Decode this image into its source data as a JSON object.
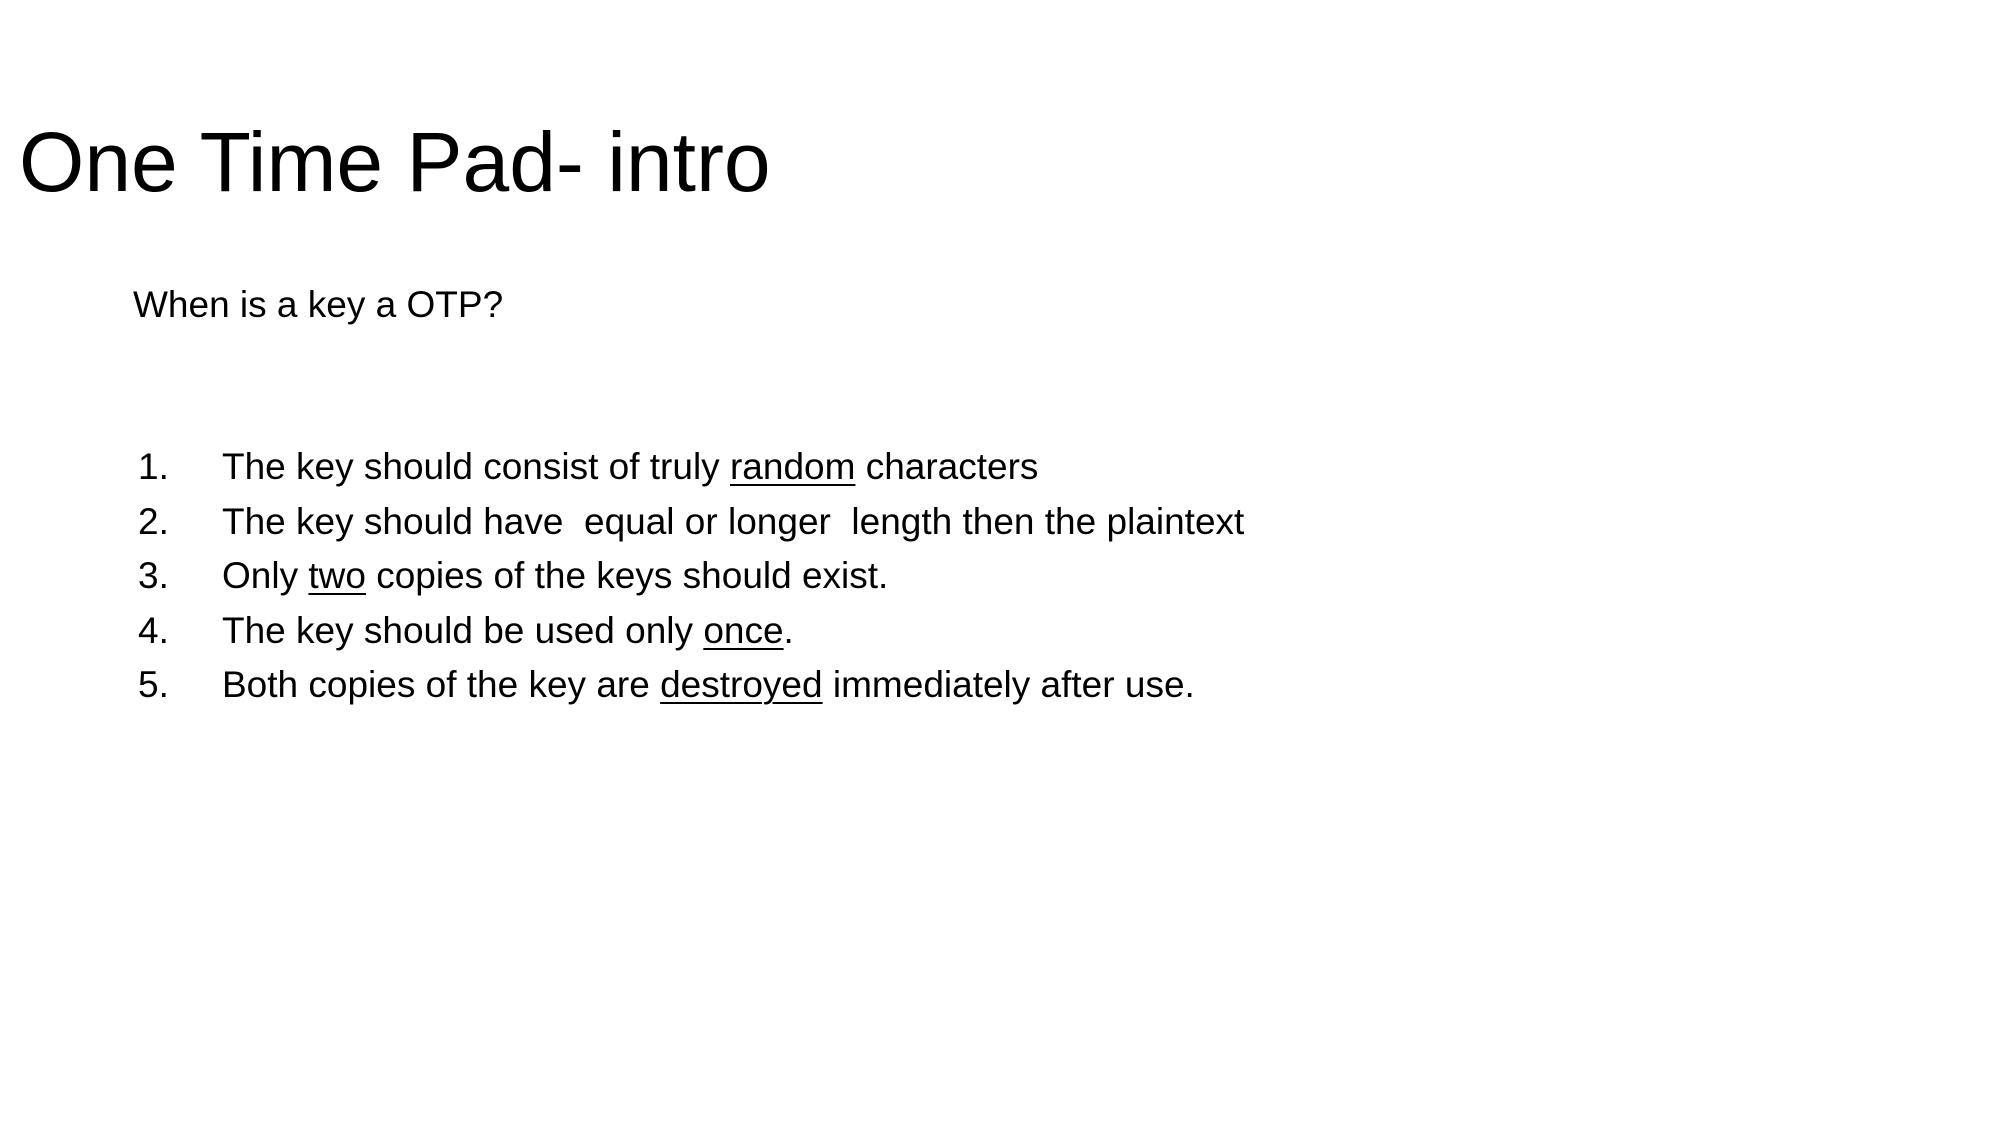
{
  "slide": {
    "title": "One Time Pad- intro",
    "subtitle": "When is a key a OTP?",
    "items": [
      {
        "number": "1.",
        "before": "The key should consist of truly ",
        "emphasis": "random",
        "after": " characters"
      },
      {
        "number": "2.",
        "before": "The key should have  equal or longer  length then the plaintext",
        "emphasis": "",
        "after": ""
      },
      {
        "number": "3.",
        "before": "Only ",
        "emphasis": "two",
        "after": " copies of the keys should exist."
      },
      {
        "number": "4.",
        "before": "The key should be used only ",
        "emphasis": "once",
        "after": "."
      },
      {
        "number": "5.",
        "before": "Both copies of the key are ",
        "emphasis": "destroyed",
        "after": " immediately after use."
      }
    ]
  }
}
